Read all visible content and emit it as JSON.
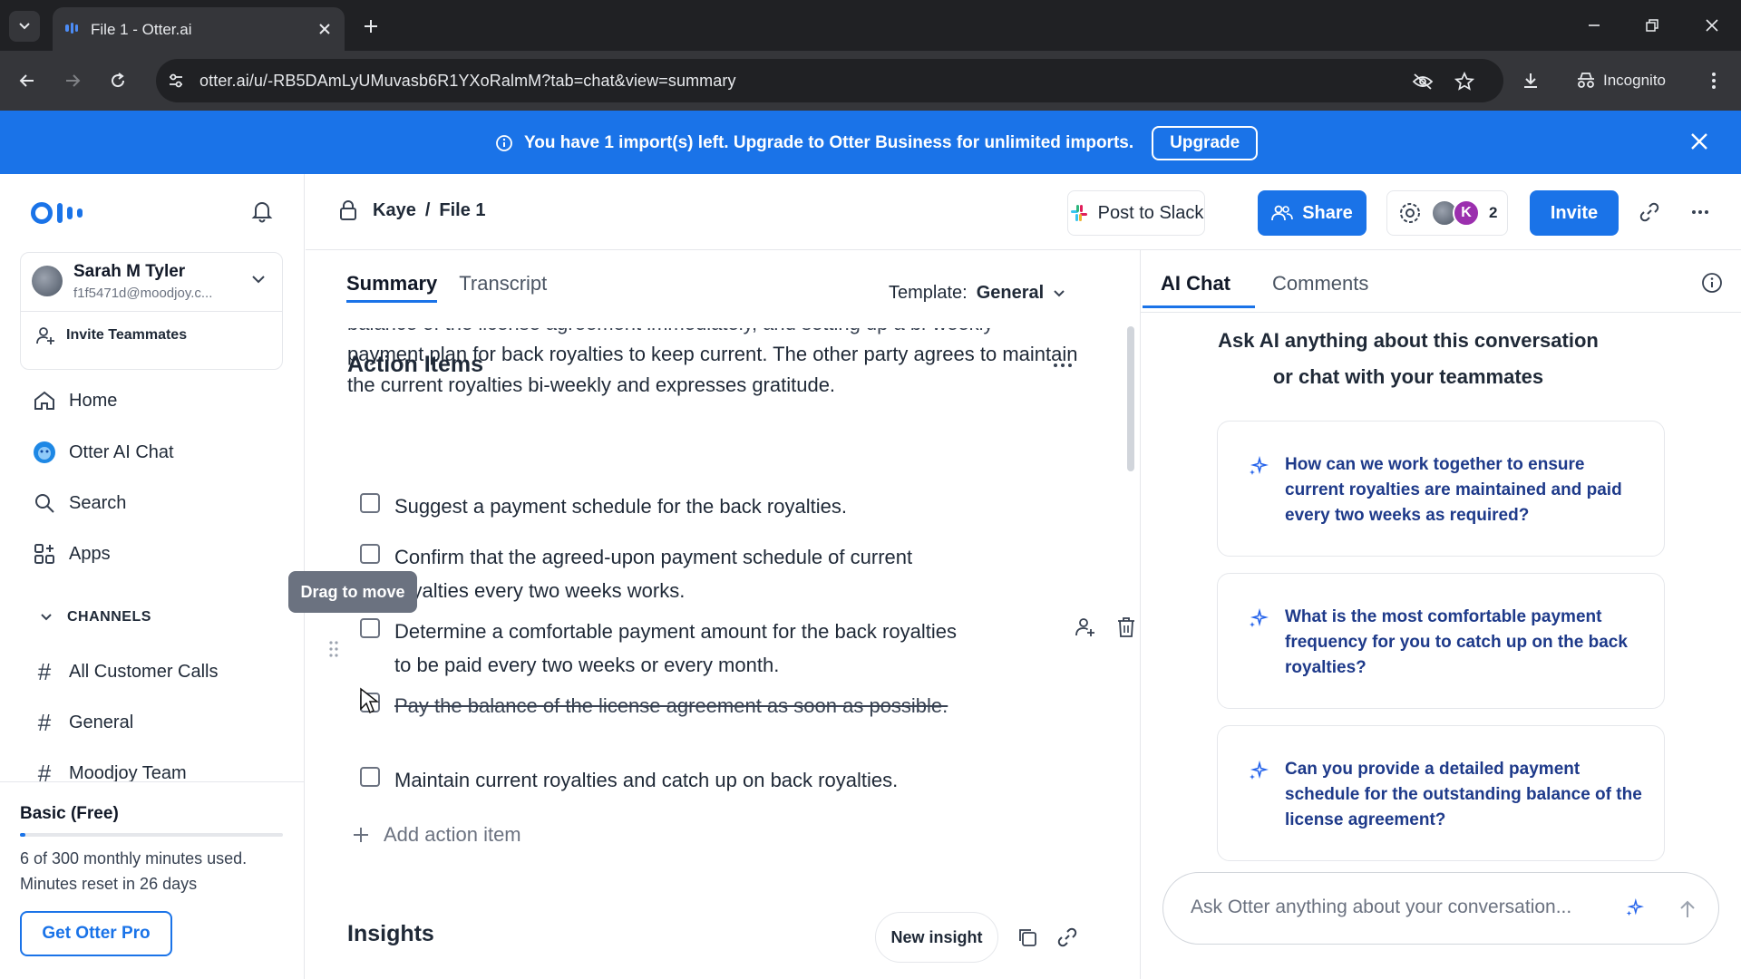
{
  "browser": {
    "tab_title": "File 1 - Otter.ai",
    "url": "otter.ai/u/-RB5DAmLyUMuvasb6R1YXoRalmM?tab=chat&view=summary",
    "incognito_label": "Incognito"
  },
  "banner": {
    "message": "You have 1 import(s) left. Upgrade to Otter Business for unlimited imports.",
    "upgrade_label": "Upgrade"
  },
  "sidebar": {
    "user_name": "Sarah M Tyler",
    "user_email": "f1f5471d@moodjoy.c...",
    "invite_teammates": "Invite Teammates",
    "nav": [
      {
        "label": "Home",
        "icon": "home-icon"
      },
      {
        "label": "Otter AI Chat",
        "icon": "otter-ai-icon"
      },
      {
        "label": "Search",
        "icon": "search-icon"
      },
      {
        "label": "Apps",
        "icon": "apps-icon"
      }
    ],
    "channels_heading": "CHANNELS",
    "channels": [
      "All Customer Calls",
      "General",
      "Moodjoy Team"
    ],
    "plan": {
      "name": "Basic (Free)",
      "usage": "6 of 300 monthly minutes used.",
      "reset": "Minutes reset in 26 days",
      "usage_fraction": 0.02,
      "cta": "Get Otter Pro"
    }
  },
  "header": {
    "owner": "Kaye",
    "separator": "/",
    "file": "File 1",
    "post_to_slack": "Post to Slack",
    "share": "Share",
    "avatar_initial": "K",
    "participant_count": "2",
    "invite": "Invite"
  },
  "summary": {
    "tabs": {
      "summary": "Summary",
      "transcript": "Transcript"
    },
    "template_label": "Template:",
    "template_value": "General",
    "cut_line": "balance of the license agreement immediately, and setting up a bi-weekly",
    "paragraph": "payment plan for back royalties to keep current. The other party agrees to maintain the current royalties bi-weekly and expresses gratitude.",
    "action_items_heading": "Action Items",
    "action_items": [
      {
        "text": "Suggest a payment schedule for the back royalties.",
        "done": false
      },
      {
        "text": "Confirm that the agreed-upon payment schedule of current royalties every two weeks works.",
        "done": false
      },
      {
        "text": "Determine a comfortable payment amount for the back royalties to be paid every two weeks or every month.",
        "done": false
      },
      {
        "text": "Pay the balance of the license agreement as soon as possible.",
        "done": true
      },
      {
        "text": "Maintain current royalties and catch up on back royalties.",
        "done": false
      }
    ],
    "drag_tooltip": "Drag to move",
    "add_action_item": "Add action item",
    "insights_heading": "Insights",
    "new_insight": "New insight"
  },
  "chat": {
    "tabs": {
      "ai_chat": "AI Chat",
      "comments": "Comments"
    },
    "intro_line1": "Ask AI anything about this conversation",
    "intro_line2": "or chat with your teammates",
    "suggestions": [
      "How can we work together to ensure current royalties are maintained and paid every two weeks as required?",
      "What is the most comfortable payment frequency for you to catch up on the back royalties?",
      "Can you provide a detailed payment schedule for the outstanding balance of the license agreement?"
    ],
    "input_placeholder": "Ask Otter anything about your conversation..."
  },
  "colors": {
    "accent": "#1a73e8",
    "banner_bg": "#1a73e8",
    "suggestion_text": "#1e3a8a",
    "avatar_k": "#9b2fae"
  }
}
